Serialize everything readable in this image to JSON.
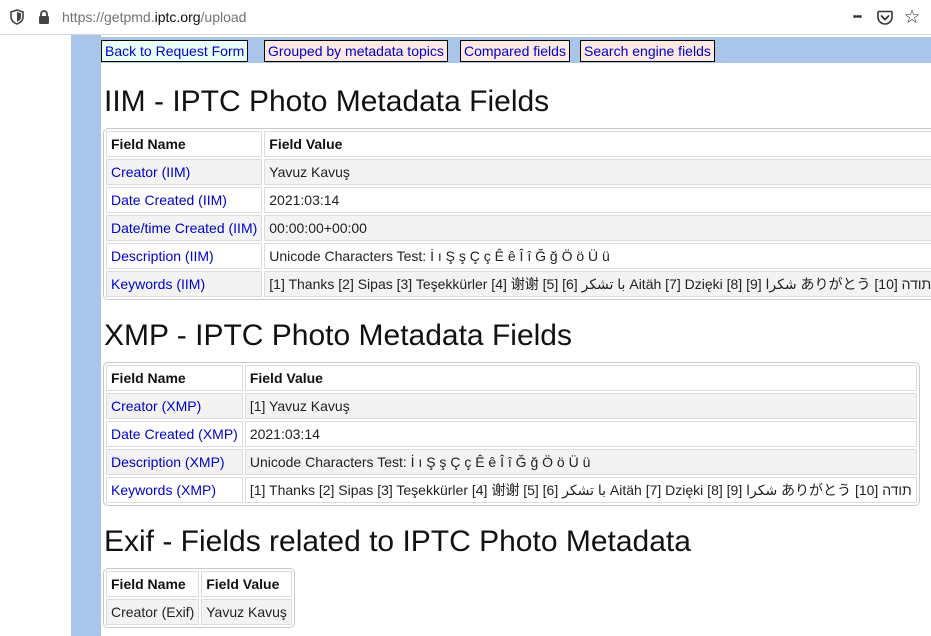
{
  "browser": {
    "url_prefix": "https://getpmd.",
    "url_host": "iptc.org",
    "url_path": "/upload",
    "icons": [
      "shield-icon",
      "lock-icon",
      "more-icon",
      "pocket-icon",
      "star-icon"
    ],
    "more_glyph": "•••",
    "star_glyph": "☆"
  },
  "nav": {
    "back": "Back to Request Form",
    "grouped": "Grouped by metadata topics",
    "compared": "Compared fields",
    "search": "Search engine fields"
  },
  "iim": {
    "heading": "IIM - IPTC Photo Metadata Fields",
    "header_name": "Field Name",
    "header_value": "Field Value",
    "rows": [
      {
        "name": "Creator (IIM)",
        "value": "Yavuz Kavuş"
      },
      {
        "name": "Date Created (IIM)",
        "value": "2021:03:14"
      },
      {
        "name": "Date/time Created (IIM)",
        "value": "00:00:00+00:00"
      },
      {
        "name": "Description (IIM)",
        "value": "Unicode Characters Test: İ ı Ş ş Ç ç Ê ê Î î Ğ ğ Ö ö Ü ü"
      },
      {
        "name": "Keywords (IIM)",
        "value": "[1] Thanks [2] Sipas [3] Teşekkürler [4] 谢谢 [5] [6] با تشکر Aitäh [7] Dzięki [8] [9] شكرا ありがとう [10] תודה"
      }
    ]
  },
  "xmp": {
    "heading": "XMP - IPTC Photo Metadata Fields",
    "header_name": "Field Name",
    "header_value": "Field Value",
    "rows": [
      {
        "name": "Creator (XMP)",
        "value": "[1] Yavuz Kavuş"
      },
      {
        "name": "Date Created (XMP)",
        "value": "2021:03:14"
      },
      {
        "name": "Description (XMP)",
        "value": "Unicode Characters Test: İ ı Ş ş Ç ç Ê ê Î î Ğ ğ Ö ö Ü ü"
      },
      {
        "name": "Keywords (XMP)",
        "value": "[1] Thanks [2] Sipas [3] Teşekkürler [4] 谢谢 [5] [6] با تشکر Aitäh [7] Dzięki [8] [9] شكرا ありがとう [10] תודה"
      }
    ]
  },
  "exif": {
    "heading": "Exif - Fields related to IPTC Photo Metadata",
    "header_name": "Field Name",
    "header_value": "Field Value",
    "rows": [
      {
        "name": "Creator (Exif)",
        "value": "Yavuz Kavuş"
      }
    ]
  }
}
